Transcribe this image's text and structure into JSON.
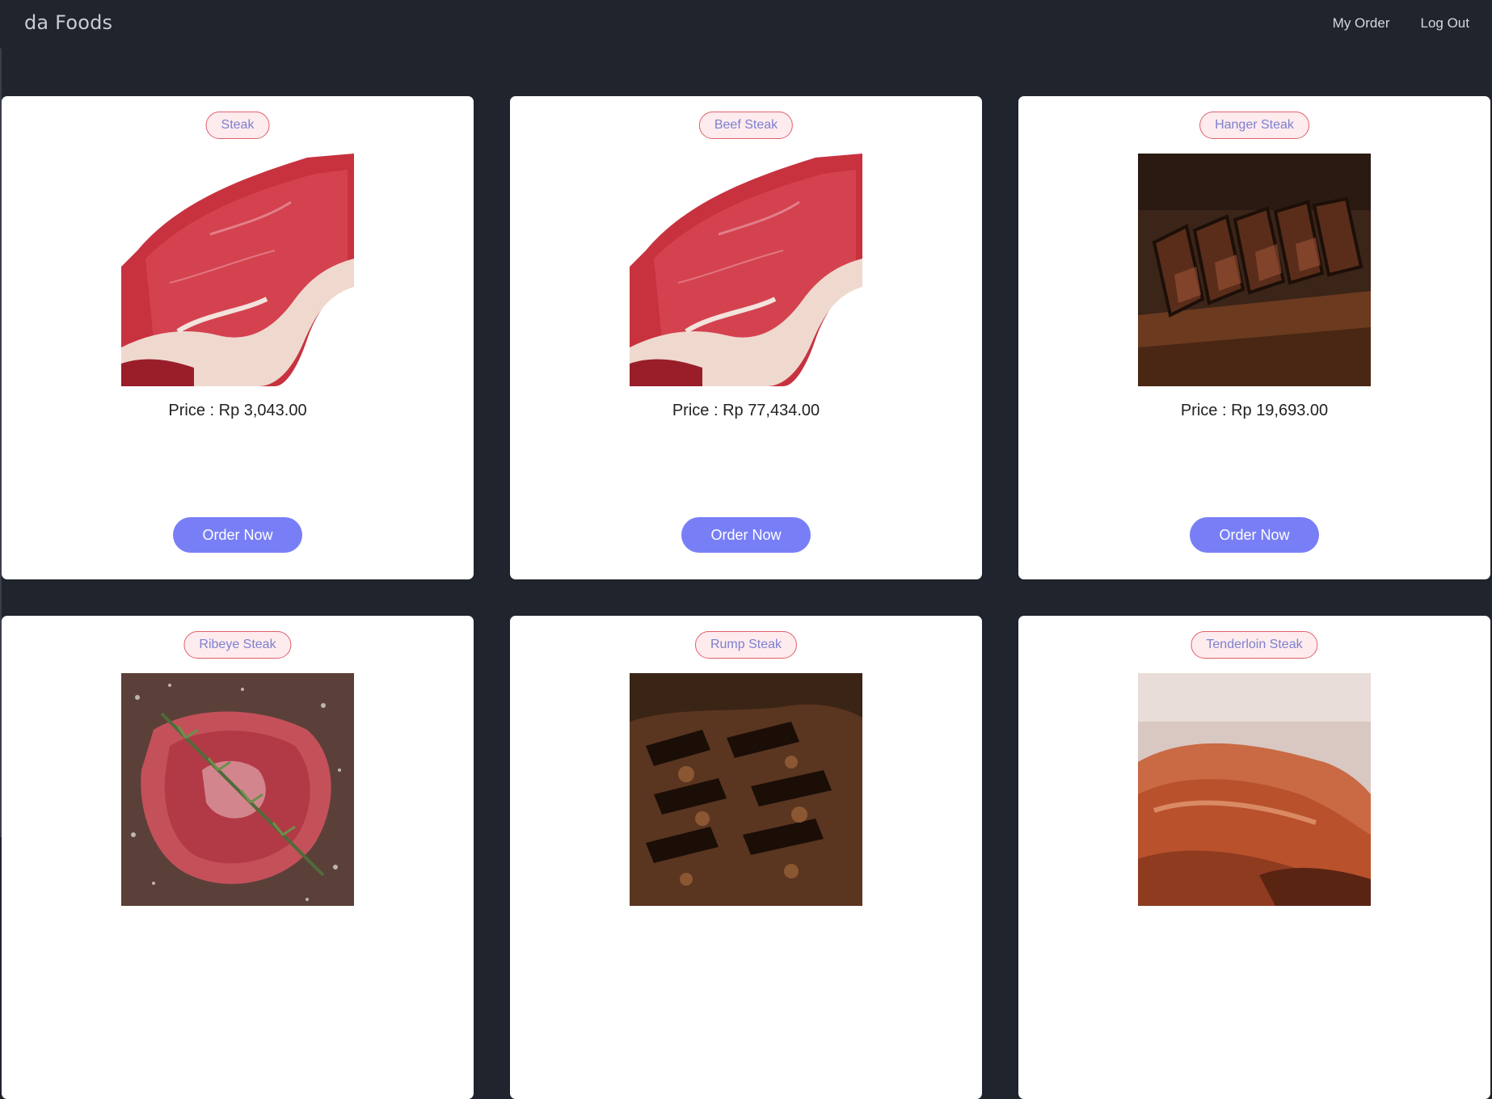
{
  "navbar": {
    "brand": "da Foods",
    "links": [
      "My Order",
      "Log Out"
    ]
  },
  "products": [
    {
      "name": "Steak",
      "price": "Price : Rp 3,043.00",
      "button": "Order Now",
      "image": "raw-tbone-steak"
    },
    {
      "name": "Beef Steak",
      "price": "Price : Rp 77,434.00",
      "button": "Order Now",
      "image": "raw-tbone-steak"
    },
    {
      "name": "Hanger Steak",
      "price": "Price : Rp 19,693.00",
      "button": "Order Now",
      "image": "sliced-grilled-steak"
    },
    {
      "name": "Ribeye Steak",
      "price": "",
      "button": "",
      "image": "raw-ribeye-rosemary"
    },
    {
      "name": "Rump Steak",
      "price": "",
      "button": "",
      "image": "charred-grilled-steak"
    },
    {
      "name": "Tenderloin Steak",
      "price": "",
      "button": "",
      "image": "roasted-tenderloin"
    }
  ],
  "colors": {
    "background": "#1f242d",
    "card": "#ffffff",
    "badge_border": "#e0606a",
    "badge_fill": "#fdebee",
    "badge_text": "#7e7fcf",
    "button": "#787ff6"
  }
}
